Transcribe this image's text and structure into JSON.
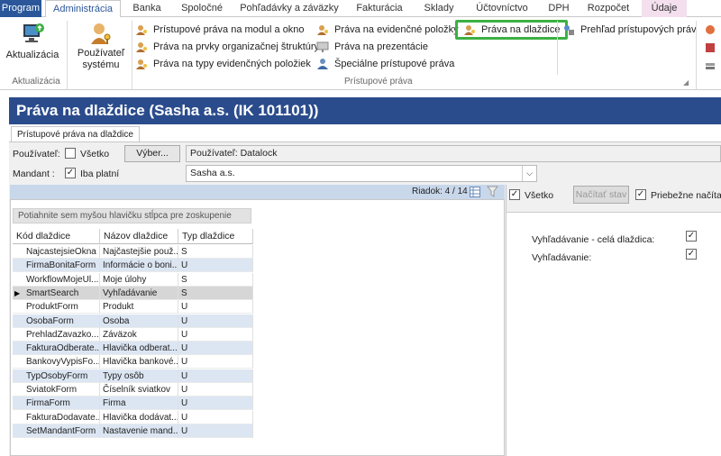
{
  "tabs": [
    {
      "label": "Program"
    },
    {
      "label": "Administrácia"
    },
    {
      "label": "Banka"
    },
    {
      "label": "Spoločné"
    },
    {
      "label": "Pohľadávky a záväzky"
    },
    {
      "label": "Fakturácia"
    },
    {
      "label": "Sklady"
    },
    {
      "label": "Účtovníctvo"
    },
    {
      "label": "DPH"
    },
    {
      "label": "Rozpočet"
    },
    {
      "label": "Údaje"
    }
  ],
  "ribbon": {
    "aktualizacia": "Aktualizácia",
    "pouzivatel_line1": "Používateľ",
    "pouzivatel_line2": "systému",
    "group_aktualizacia": "Aktualizácia",
    "group_pristupove": "Prístupové práva",
    "items": [
      "Prístupové práva na modul a okno",
      "Práva na prvky organizačnej štruktúry",
      "Práva na typy evidenčných položiek",
      "Práva na evidenčné položky",
      "Práva na prezentácie",
      "Špeciálne prístupové práva",
      "Práva na dlaždice",
      "Prehľad prístupových práv"
    ]
  },
  "window": {
    "title": "Práva na dlaždice (Sasha a.s. (IK 101101))",
    "subtab": "Prístupové práva na dlaždice"
  },
  "filters": {
    "user_label": "Používateľ:",
    "all_label": "Všetko",
    "select_button": "Výber...",
    "user_value": "Používateľ: Datalock",
    "mandant_label": "Mandant :",
    "only_valid_label": "Iba platní",
    "mandant_value": "Sasha a.s."
  },
  "grid": {
    "row_counter": "Riadok: 4 / 14",
    "group_hint": "Potiahnite sem myšou hlavičku stĺpca pre zoskupenie",
    "columns": [
      "Kód dlaždice",
      "Názov dlaždice",
      "Typ dlaždice"
    ],
    "rows": [
      [
        "NajcastejsieOkna",
        "Najčastejšie použ...",
        "S"
      ],
      [
        "FirmaBonitaForm",
        "Informácie o boni...",
        "U"
      ],
      [
        "WorkflowMojeUl...",
        "Moje úlohy",
        "S"
      ],
      [
        "SmartSearch",
        "Vyhľadávanie",
        "S"
      ],
      [
        "ProduktForm",
        "Produkt",
        "U"
      ],
      [
        "OsobaForm",
        "Osoba",
        "U"
      ],
      [
        "PrehladZavazko...",
        "Záväzok",
        "U"
      ],
      [
        "FakturaOdberate...",
        "Hlavička odberat...",
        "U"
      ],
      [
        "BankovyVypisFo...",
        "Hlavička bankové...",
        "U"
      ],
      [
        "TypOsobyForm",
        "Typy osôb",
        "U"
      ],
      [
        "SviatokForm",
        "Číselník sviatkov",
        "U"
      ],
      [
        "FirmaForm",
        "Firma",
        "U"
      ],
      [
        "FakturaDodavate...",
        "Hlavička dodávat...",
        "U"
      ],
      [
        "SetMandantForm",
        "Nastavenie mand...",
        "U"
      ]
    ],
    "selected_index": 3
  },
  "right": {
    "all_label": "Všetko",
    "load_button": "Načítať stav",
    "continuous_label": "Priebežne načítava",
    "items": [
      {
        "label": "Vyhľadávanie - celá dlaždica:",
        "checked": true
      },
      {
        "label": "Vyhľadávanie:",
        "checked": true
      }
    ]
  },
  "colors": {
    "accent": "#2b579a",
    "title_bg": "#2b4c8c",
    "highlight": "#3cb043",
    "grid_alt": "#dce6f3",
    "grid_selected": "#d6d6d6"
  }
}
